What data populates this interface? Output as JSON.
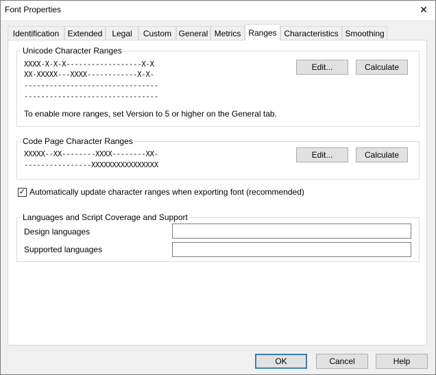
{
  "window": {
    "title": "Font Properties",
    "close_glyph": "✕"
  },
  "tabs": [
    {
      "label": "Identification",
      "active": false
    },
    {
      "label": "Extended",
      "active": false
    },
    {
      "label": "Legal",
      "active": false
    },
    {
      "label": "Custom",
      "active": false
    },
    {
      "label": "General",
      "active": false
    },
    {
      "label": "Metrics",
      "active": false
    },
    {
      "label": "Ranges",
      "active": true
    },
    {
      "label": "Characteristics",
      "active": false
    },
    {
      "label": "Smoothing",
      "active": false
    }
  ],
  "unicode_group": {
    "title": "Unicode Character Ranges",
    "lines": [
      "XXXX-X-X-X------------------X-X",
      "XX-XXXXX---XXXX------------X-X-",
      "--------------------------------",
      "--------------------------------"
    ],
    "note": "To enable more ranges, set Version to 5 or higher on the General tab.",
    "edit_label": "Edit...",
    "calculate_label": "Calculate"
  },
  "codepage_group": {
    "title": "Code Page Character Ranges",
    "lines": [
      "XXXXX--XX--------XXXX--------XX-",
      "----------------XXXXXXXXXXXXXXXX"
    ],
    "edit_label": "Edit...",
    "calculate_label": "Calculate"
  },
  "auto_update": {
    "label": "Automatically update character ranges when exporting font (recommended)",
    "checked": true,
    "check_glyph": "✓"
  },
  "languages_group": {
    "title": "Languages and Script Coverage and Support",
    "design_label": "Design languages",
    "design_value": "",
    "supported_label": "Supported languages",
    "supported_value": ""
  },
  "footer": {
    "ok_label": "OK",
    "cancel_label": "Cancel",
    "help_label": "Help"
  }
}
